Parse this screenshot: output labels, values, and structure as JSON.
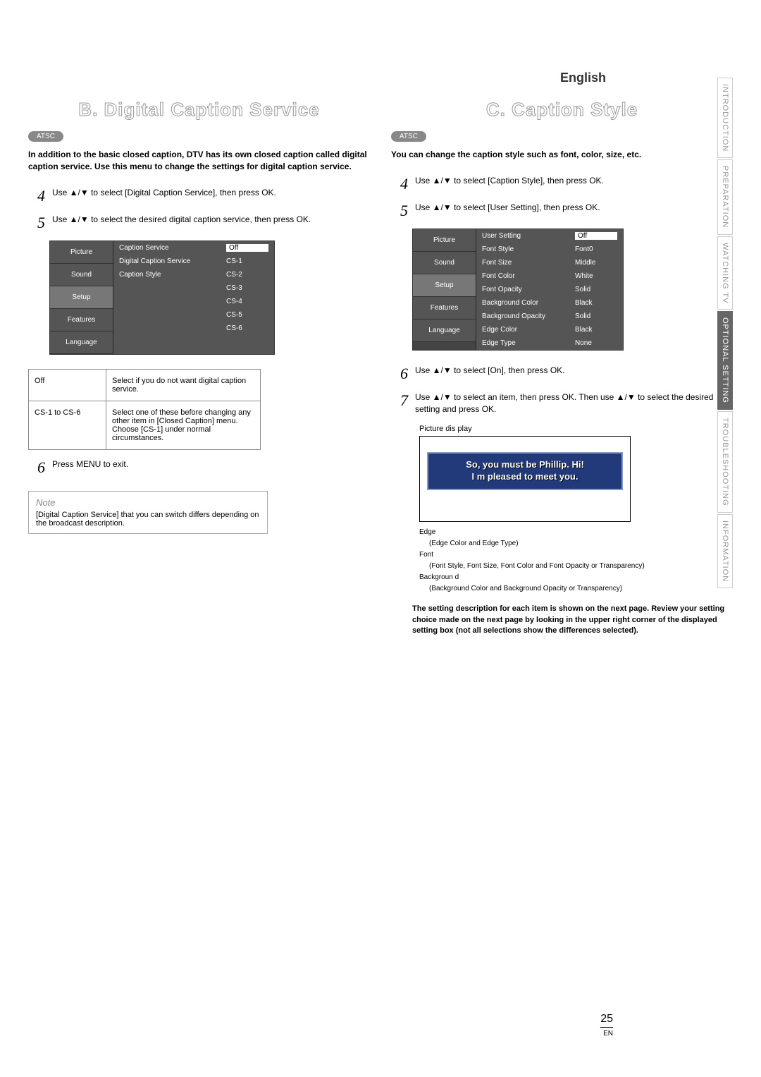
{
  "lang": "English",
  "side_tabs": {
    "introduction": "INTRODUCTION",
    "preparation": "PREPARATION",
    "watching_tv": "WATCHING TV",
    "optional_setting": "OPTIONAL SETTING",
    "troubleshooting": "TROUBLESHOOTING",
    "information": "INFORMATION"
  },
  "left": {
    "title": "B. Digital Caption Service",
    "badge": "ATSC",
    "intro": "In addition to the basic closed caption, DTV has its own closed caption called digital caption service. Use this menu to change the settings for digital caption service.",
    "step4": "Use ▲/▼ to select [Digital Caption Service], then press OK.",
    "step5": "Use ▲/▼ to select the desired digital caption service, then press OK.",
    "menu": {
      "tabs": {
        "picture": "Picture",
        "sound": "Sound",
        "setup": "Setup",
        "features": "Features",
        "language": "Language"
      },
      "rows": {
        "caption_service": {
          "label": "Caption Service",
          "val": "Off"
        },
        "digital_caption_service": {
          "label": "Digital Caption Service",
          "val": "CS-1"
        },
        "caption_style": {
          "label": "Caption Style",
          "val": "CS-2"
        },
        "cs3": "CS-3",
        "cs4": "CS-4",
        "cs5": "CS-5",
        "cs6": "CS-6"
      }
    },
    "opts": {
      "off": {
        "name": "Off",
        "desc": "Select if you do not want digital caption service."
      },
      "cs": {
        "name": "CS-1 to CS-6",
        "desc": "Select one of these before changing any other item in [Closed Caption] menu. Choose [CS-1] under normal circumstances."
      }
    },
    "step6": "Press MENU to exit.",
    "note_label": "Note",
    "note": "[Digital Caption Service] that you can switch differs depending on the broadcast description."
  },
  "right": {
    "title": "C. Caption Style",
    "badge": "ATSC",
    "intro": "You can change the caption style such as font, color, size, etc.",
    "step4": "Use ▲/▼ to select [Caption Style], then press OK.",
    "step5": "Use ▲/▼ to select [User Setting], then press OK.",
    "menu": {
      "tabs": {
        "picture": "Picture",
        "sound": "Sound",
        "setup": "Setup",
        "features": "Features",
        "language": "Language"
      },
      "rows": {
        "user_setting": {
          "label": "User Setting",
          "val": "Off"
        },
        "font_style": {
          "label": "Font Style",
          "val": "Font0"
        },
        "font_size": {
          "label": "Font Size",
          "val": "Middle"
        },
        "font_color": {
          "label": "Font Color",
          "val": "White"
        },
        "font_opacity": {
          "label": "Font Opacity",
          "val": "Solid"
        },
        "background_color": {
          "label": "Background Color",
          "val": "Black"
        },
        "background_opacity": {
          "label": "Background Opacity",
          "val": "Solid"
        },
        "edge_color": {
          "label": "Edge Color",
          "val": "Black"
        },
        "edge_type": {
          "label": "Edge Type",
          "val": "None"
        }
      }
    },
    "step6": "Use ▲/▼ to select [On], then press OK.",
    "step7": "Use ▲/▼ to select an item, then press OK. Then use ▲/▼ to select the desired setting and press OK.",
    "preview_title": "Picture dis play",
    "bubble_line1": "So, you must be Phillip. Hi!",
    "bubble_line2": "I m pleased to meet you.",
    "legend": {
      "edge": "Edge",
      "edge_sub": "(Edge Color and Edge Type)",
      "font": "Font",
      "font_sub": "(Font Style, Font Size, Font Color and Font Opacity or Transparency)",
      "background": "Backgroun d",
      "background_sub": "(Background Color and Background Opacity or Transparency)"
    },
    "closing": "The setting description for each item is shown on the next page.\nReview your setting choice made on the next page by looking in the upper right corner of the displayed setting box (not all selections show the differences selected)."
  },
  "page_number": "25",
  "page_number_sub": "EN"
}
